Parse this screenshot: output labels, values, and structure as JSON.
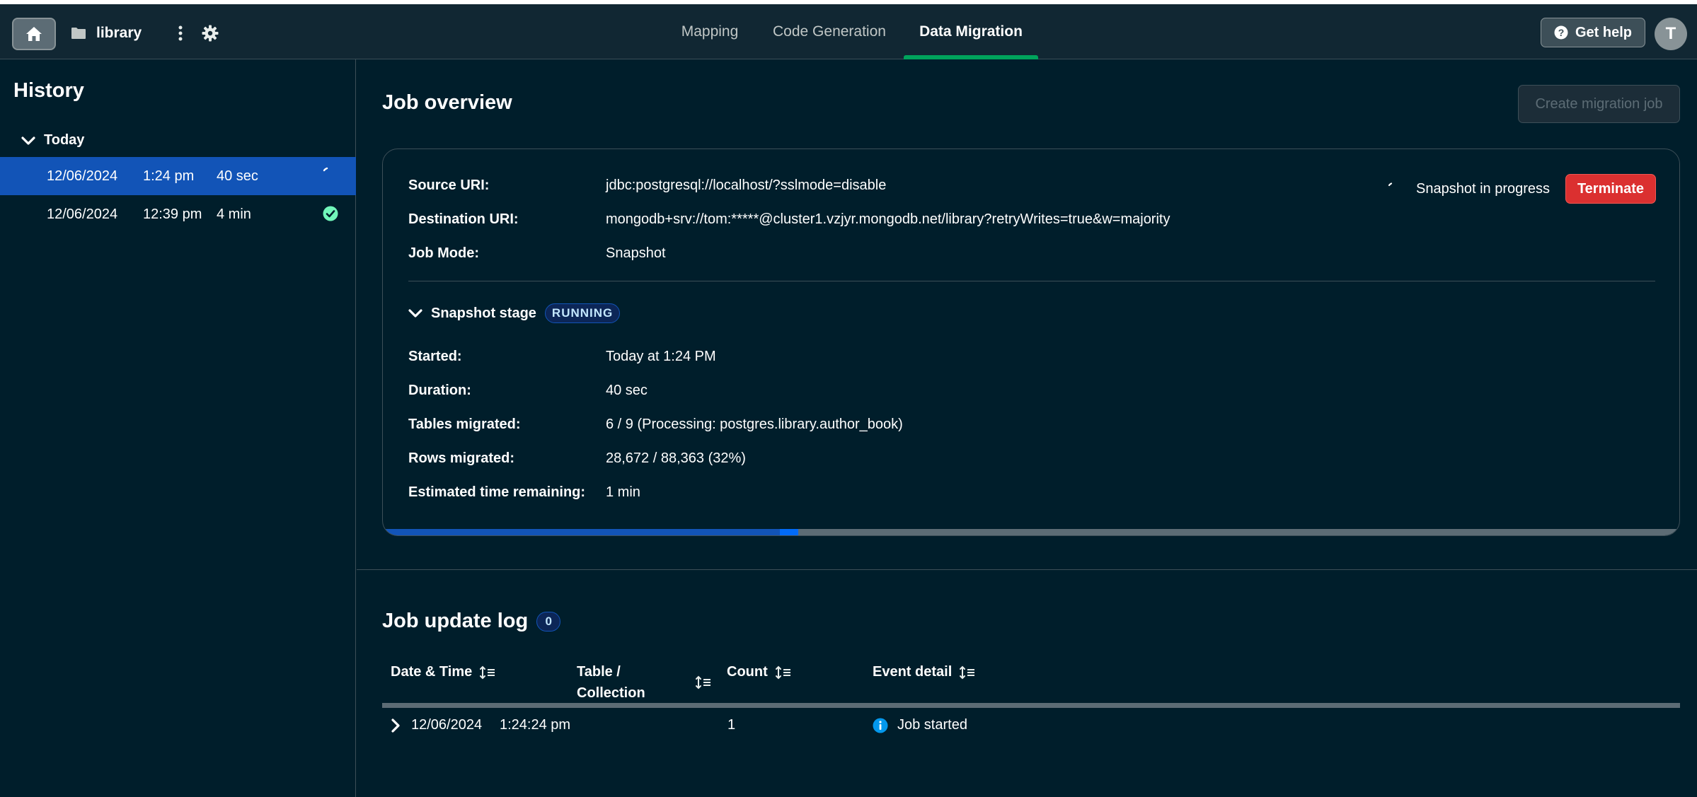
{
  "topbar": {
    "project_name": "library",
    "tabs": [
      {
        "label": "Mapping",
        "active": false
      },
      {
        "label": "Code Generation",
        "active": false
      },
      {
        "label": "Data Migration",
        "active": true
      }
    ],
    "help_label": "Get help",
    "avatar_initial": "T"
  },
  "sidebar": {
    "title": "History",
    "group_label": "Today",
    "rows": [
      {
        "date": "12/06/2024",
        "time": "1:24 pm",
        "duration": "40 sec",
        "status": "in-progress",
        "selected": true
      },
      {
        "date": "12/06/2024",
        "time": "12:39 pm",
        "duration": "4 min",
        "status": "success",
        "selected": false
      }
    ]
  },
  "overview": {
    "title": "Job overview",
    "create_button": "Create migration job",
    "source_label": "Source URI:",
    "source_value": "jdbc:postgresql://localhost/?sslmode=disable",
    "dest_label": "Destination URI:",
    "dest_value": "mongodb+srv://tom:*****@cluster1.vzjyr.mongodb.net/library?retryWrites=true&w=majority",
    "mode_label": "Job Mode:",
    "mode_value": "Snapshot",
    "status_text": "Snapshot in progress",
    "terminate_label": "Terminate",
    "stage": {
      "title": "Snapshot stage",
      "badge": "RUNNING",
      "started_label": "Started:",
      "started_value": "Today at 1:24 PM",
      "duration_label": "Duration:",
      "duration_value": "40 sec",
      "tables_label": "Tables migrated:",
      "tables_value": "6 / 9 (Processing: postgres.library.author_book)",
      "rows_label": "Rows migrated:",
      "rows_value": "28,672 / 88,363 (32%)",
      "eta_label": "Estimated time remaining:",
      "eta_value": "1 min",
      "progress_fraction": 0.32
    }
  },
  "log": {
    "title": "Job update log",
    "count": "0",
    "columns": {
      "datetime": "Date & Time",
      "table_line1": "Table /",
      "table_line2": "Collection",
      "count": "Count",
      "detail": "Event detail"
    },
    "rows": [
      {
        "date": "12/06/2024",
        "time": "1:24:24 pm",
        "table": "",
        "count": "1",
        "detail": "Job started"
      }
    ]
  },
  "colors": {
    "accent_green": "#00a35c",
    "selected_blue": "#1254b7",
    "danger_red": "#db3030",
    "success_green": "#71f6ba"
  }
}
